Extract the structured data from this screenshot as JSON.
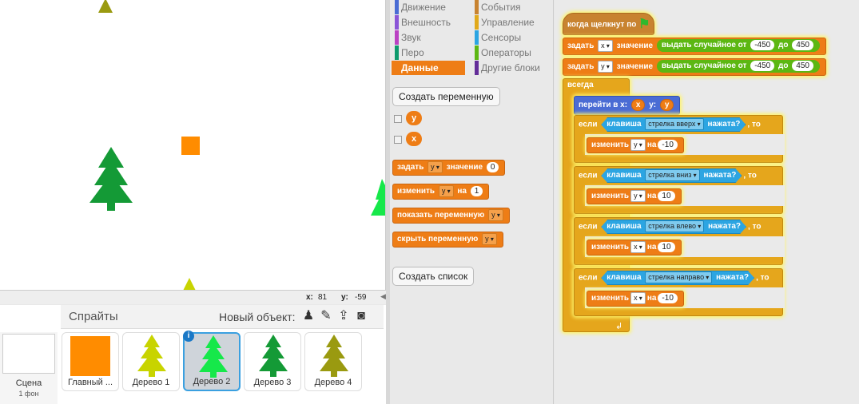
{
  "stage": {
    "coords": {
      "x_label": "x:",
      "x_value": "81",
      "y_label": "y:",
      "y_value": "-59"
    }
  },
  "sprites_pane": {
    "title": "Спрайты",
    "new_object_label": "Новый объект:",
    "scene": {
      "label": "Сцена",
      "backdrops": "1 фон"
    },
    "sprites": [
      {
        "name": "Главный ...",
        "color": "#ff8c00",
        "kind": "square",
        "selected": false
      },
      {
        "name": "Дерево 1",
        "color": "#c8d400",
        "kind": "tree",
        "selected": false
      },
      {
        "name": "Дерево 2",
        "color": "#16e84a",
        "kind": "tree",
        "selected": true
      },
      {
        "name": "Дерево 3",
        "color": "#149a36",
        "kind": "tree",
        "selected": false
      },
      {
        "name": "Дерево 4",
        "color": "#9a9a10",
        "kind": "tree",
        "selected": false
      }
    ]
  },
  "palette": {
    "categories_left": [
      {
        "label": "Движение",
        "color": "#4a6cd4"
      },
      {
        "label": "Внешность",
        "color": "#8a55d7"
      },
      {
        "label": "Звук",
        "color": "#bb42c3"
      },
      {
        "label": "Перо",
        "color": "#0e9a6c"
      },
      {
        "label": "Данные",
        "color": "#ee7d16",
        "active": true
      }
    ],
    "categories_right": [
      {
        "label": "События",
        "color": "#c88330"
      },
      {
        "label": "Управление",
        "color": "#e1a91a"
      },
      {
        "label": "Сенсоры",
        "color": "#2ca5e2"
      },
      {
        "label": "Операторы",
        "color": "#5cb712"
      },
      {
        "label": "Другие блоки",
        "color": "#632d99"
      }
    ],
    "make_variable": "Создать переменную",
    "variables": [
      "y",
      "x"
    ],
    "set_block": {
      "word": "задать",
      "var": "y",
      "word2": "значение",
      "value": "0"
    },
    "change_block": {
      "word": "изменить",
      "var": "y",
      "word2": "на",
      "value": "1"
    },
    "show_block": {
      "word": "показать переменную",
      "var": "y"
    },
    "hide_block": {
      "word": "скрыть переменную",
      "var": "y"
    },
    "make_list": "Создать список"
  },
  "script": {
    "hat": "когда щелкнут по",
    "set_x": {
      "word": "задать",
      "var": "x",
      "word2": "значение",
      "op": "выдать случайное от",
      "from": "-450",
      "to_word": "до",
      "to": "450"
    },
    "set_y": {
      "word": "задать",
      "var": "y",
      "word2": "значение",
      "op": "выдать случайное от",
      "from": "-450",
      "to_word": "до",
      "to": "450"
    },
    "forever": "всегда",
    "goto": {
      "word": "перейти в x:",
      "x": "x",
      "y_word": "y:",
      "y": "y"
    },
    "ifs": [
      {
        "if": "если",
        "key": "клавиша",
        "key_name": "стрелка вверх",
        "pressed": "нажата?",
        "then": ", то",
        "change": "изменить",
        "var": "y",
        "by": "на",
        "value": "-10"
      },
      {
        "if": "если",
        "key": "клавиша",
        "key_name": "стрелка вниз",
        "pressed": "нажата?",
        "then": ", то",
        "change": "изменить",
        "var": "y",
        "by": "на",
        "value": "10"
      },
      {
        "if": "если",
        "key": "клавиша",
        "key_name": "стрелка влево",
        "pressed": "нажата?",
        "then": ", то",
        "change": "изменить",
        "var": "x",
        "by": "на",
        "value": "10"
      },
      {
        "if": "если",
        "key": "клавиша",
        "key_name": "стрелка направо",
        "pressed": "нажата?",
        "then": ", то",
        "change": "изменить",
        "var": "x",
        "by": "на",
        "value": "-10"
      }
    ]
  }
}
